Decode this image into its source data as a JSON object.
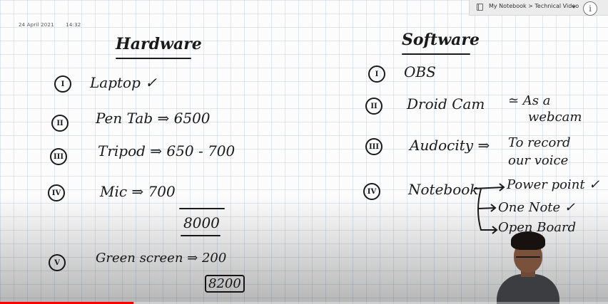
{
  "window": {
    "breadcrumb": "My Notebook > Technical Video",
    "info_icon_glyph": "i"
  },
  "page": {
    "date": "24 April 2021",
    "time": "14:32"
  },
  "hardware": {
    "title": "Hardware",
    "items": [
      {
        "num": "I",
        "text": "Laptop ✓"
      },
      {
        "num": "II",
        "text": "Pen Tab ⇒ 6500"
      },
      {
        "num": "III",
        "text": "Tripod ⇒ 650 - 700"
      },
      {
        "num": "IV",
        "text": "Mic ⇒ 700"
      },
      {
        "num": "V",
        "text": "Green screen ⇒ 200"
      }
    ],
    "subtotal": "8000",
    "total": "8200"
  },
  "software": {
    "title": "Software",
    "items": [
      {
        "num": "I",
        "text": "OBS"
      },
      {
        "num": "II",
        "text": "Droid Cam"
      },
      {
        "num": "III",
        "text": "Audocity ⇒"
      },
      {
        "num": "IV",
        "text": "Notebook"
      }
    ],
    "droidcam_note_line1": "≃ As a",
    "droidcam_note_line2": "webcam",
    "audacity_note_line1": "To record",
    "audacity_note_line2": "our voice",
    "notebook_branches": [
      "Power point ✓",
      "One Note ✓",
      "Open Board"
    ]
  },
  "video": {
    "progress": 0.22,
    "progress_color": "#ff0000"
  },
  "icons": {
    "notebook": "notebook-icon",
    "dropdown": "chevron-down-icon",
    "info": "info-icon"
  }
}
